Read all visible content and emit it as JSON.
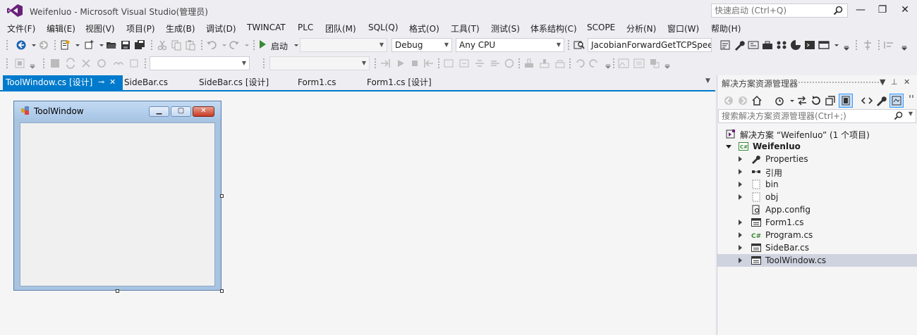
{
  "window": {
    "title": "Weifenluo - Microsoft Visual Studio(管理员)",
    "quick_launch_placeholder": "快速启动 (Ctrl+Q)",
    "minimize": "—",
    "restore": "❐",
    "close": "✕"
  },
  "menu": [
    "文件(F)",
    "编辑(E)",
    "视图(V)",
    "项目(P)",
    "生成(B)",
    "调试(D)",
    "TWINCAT",
    "PLC",
    "团队(M)",
    "SQL(Q)",
    "格式(O)",
    "工具(T)",
    "测试(S)",
    "体系结构(C)",
    "SCOPE",
    "分析(N)",
    "窗口(W)",
    "帮助(H)"
  ],
  "toolbar": {
    "start_label": "启动",
    "config": "Debug",
    "platform": "Any CPU",
    "target": "JacobianForwardGetTCPSpee"
  },
  "tabs": [
    {
      "label": "ToolWindow.cs [设计]",
      "active": true
    },
    {
      "label": "SideBar.cs",
      "active": false
    },
    {
      "label": "SideBar.cs [设计]",
      "active": false
    },
    {
      "label": "Form1.cs",
      "active": false
    },
    {
      "label": "Form1.cs [设计]",
      "active": false
    }
  ],
  "tab_buttons": {
    "pin": "⊸",
    "close": "✕"
  },
  "designer": {
    "form_title": "ToolWindow"
  },
  "solution_explorer": {
    "title": "解决方案资源管理器",
    "search_placeholder": "搜索解决方案资源管理器(Ctrl+;)",
    "nodes": [
      {
        "label": "解决方案 “Weifenluo” (1 个项目)",
        "indent": 0,
        "expander": "none",
        "icon": "solution-icon",
        "bold": false,
        "selected": false
      },
      {
        "label": "Weifenluo",
        "indent": 1,
        "expander": "open",
        "icon": "csharp-project-icon",
        "bold": true,
        "selected": false
      },
      {
        "label": "Properties",
        "indent": 2,
        "expander": "collapsed",
        "icon": "wrench-icon",
        "bold": false,
        "selected": false
      },
      {
        "label": "引用",
        "indent": 2,
        "expander": "collapsed",
        "icon": "references-icon",
        "bold": false,
        "selected": false
      },
      {
        "label": "bin",
        "indent": 2,
        "expander": "collapsed",
        "icon": "folder-icon",
        "bold": false,
        "selected": false
      },
      {
        "label": "obj",
        "indent": 2,
        "expander": "collapsed",
        "icon": "folder-icon",
        "bold": false,
        "selected": false
      },
      {
        "label": "App.config",
        "indent": 2,
        "expander": "none",
        "icon": "config-file-icon",
        "bold": false,
        "selected": false
      },
      {
        "label": "Form1.cs",
        "indent": 2,
        "expander": "collapsed",
        "icon": "form-file-icon",
        "bold": false,
        "selected": false
      },
      {
        "label": "Program.cs",
        "indent": 2,
        "expander": "collapsed",
        "icon": "csharp-file-icon",
        "bold": false,
        "selected": false
      },
      {
        "label": "SideBar.cs",
        "indent": 2,
        "expander": "collapsed",
        "icon": "form-file-icon",
        "bold": false,
        "selected": false
      },
      {
        "label": "ToolWindow.cs",
        "indent": 2,
        "expander": "collapsed",
        "icon": "form-file-icon",
        "bold": false,
        "selected": true
      }
    ]
  },
  "colors": {
    "accent": "#007acc",
    "vs_purple": "#68217a",
    "selection": "#cfd3e0"
  }
}
